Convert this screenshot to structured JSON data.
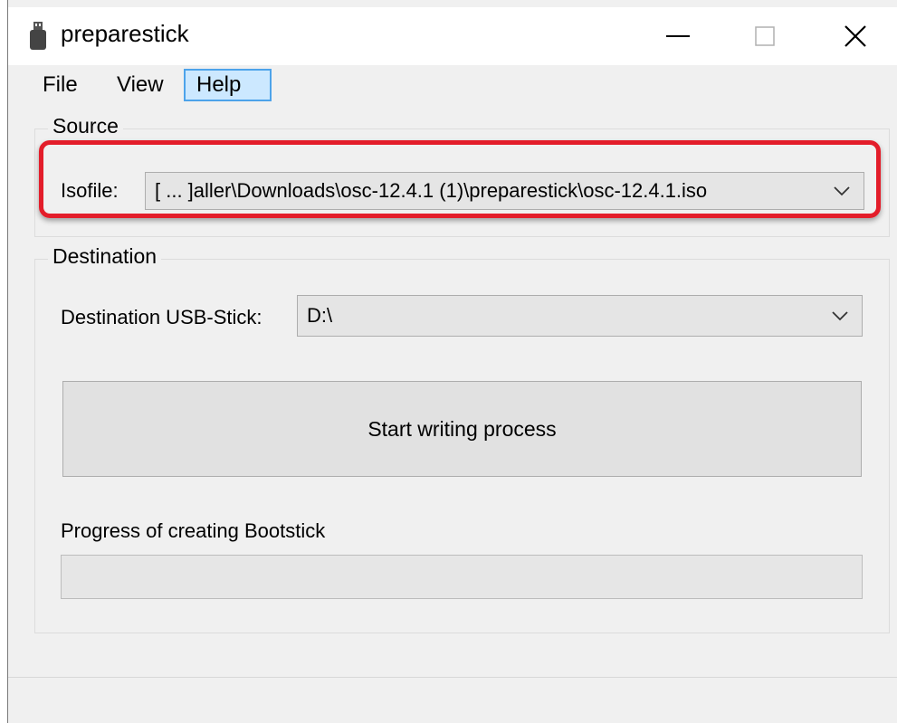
{
  "window": {
    "title": "preparestick"
  },
  "menu": {
    "items": [
      "File",
      "View",
      "Help"
    ],
    "active": "Help"
  },
  "source": {
    "group_label": "Source",
    "isofile_label": "Isofile:",
    "isofile_value": "[ ... ]aller\\Downloads\\osc-12.4.1 (1)\\preparestick\\osc-12.4.1.iso"
  },
  "destination": {
    "group_label": "Destination",
    "usb_label": "Destination USB-Stick:",
    "usb_value": "D:\\"
  },
  "actions": {
    "start_label": "Start writing process"
  },
  "progress": {
    "label": "Progress of creating Bootstick",
    "value": 0
  },
  "colors": {
    "highlight": "#e31d2a",
    "menu_active_bg": "#cce8ff",
    "menu_active_border": "#4da3ea"
  }
}
